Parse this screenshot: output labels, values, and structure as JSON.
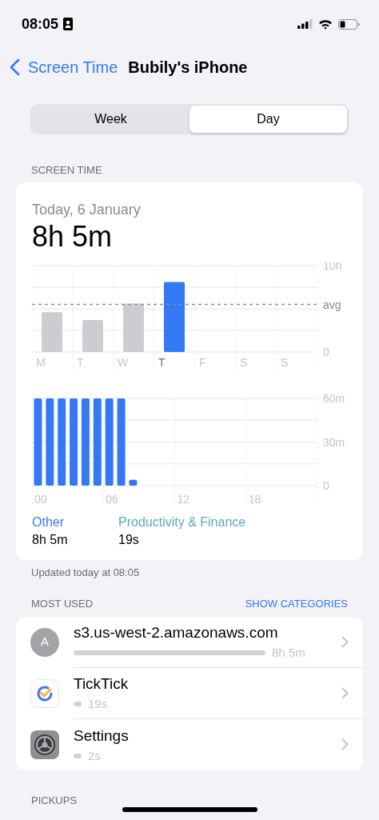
{
  "status_bar": {
    "time": "08:05"
  },
  "nav": {
    "back": "Screen Time",
    "title": "Bubily's iPhone"
  },
  "segments": [
    {
      "label": "Week",
      "selected": false
    },
    {
      "label": "Day",
      "selected": true
    }
  ],
  "screen_time": {
    "header": "SCREEN TIME",
    "date": "Today, 6 January",
    "total": "8h 5m",
    "weekly_chart": {
      "chart_data": {
        "type": "bar",
        "categories": [
          "M",
          "T",
          "W",
          "T",
          "F",
          "S",
          "S"
        ],
        "series": [
          {
            "color": "#cdcdd1",
            "values": [
              4.6,
              3.7,
              5.6,
              null,
              null,
              null,
              null
            ]
          },
          {
            "color": "#3478f6",
            "values": [
              null,
              null,
              null,
              8.1,
              null,
              null,
              null
            ]
          }
        ],
        "ylim": [
          0,
          10
        ],
        "yticks": [
          {
            "value": 0,
            "label": "0"
          },
          {
            "value": 10,
            "label": "10h"
          }
        ],
        "ref_lines": [
          {
            "axis": "y",
            "value": 5.5,
            "label": "avg"
          }
        ]
      }
    },
    "hourly_chart": {
      "chart_data": {
        "type": "bar",
        "x": [
          0,
          1,
          2,
          3,
          4,
          5,
          6,
          7,
          8
        ],
        "values": [
          60,
          60,
          60,
          60,
          60,
          60,
          60,
          60,
          4
        ],
        "xlim": [
          -0.5,
          23.5
        ],
        "ylim": [
          0,
          60
        ],
        "xticks": [
          {
            "value": 0,
            "label": "00"
          },
          {
            "value": 6,
            "label": "06"
          },
          {
            "value": 12,
            "label": "12"
          },
          {
            "value": 18,
            "label": "18"
          }
        ],
        "yticks": [
          {
            "value": 0,
            "label": "0"
          },
          {
            "value": 30,
            "label": "30m"
          },
          {
            "value": 60,
            "label": "60m"
          }
        ]
      }
    },
    "legend": [
      {
        "name": "Other",
        "value": "8h 5m",
        "color": "#3478f6"
      },
      {
        "name": "Productivity & Finance",
        "value": "19s",
        "color": "#5aaab8"
      }
    ],
    "updated": "Updated today at 08:05"
  },
  "most_used": {
    "header": "MOST USED",
    "action": "SHOW CATEGORIES",
    "items": [
      {
        "kind": "letter",
        "letter": "A",
        "name": "s3.us-west-2.amazonaws.com",
        "time": "8h 5m"
      },
      {
        "kind": "ticktick",
        "name": "TickTick",
        "time": "19s"
      },
      {
        "kind": "settings",
        "name": "Settings",
        "time": "2s"
      }
    ]
  },
  "pickups": {
    "header": "PICKUPS"
  }
}
